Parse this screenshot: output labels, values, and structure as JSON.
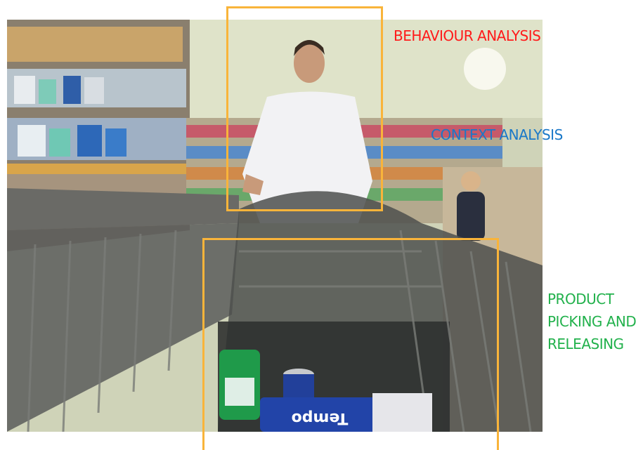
{
  "labels": {
    "behaviour": "BEHAVIOUR ANALYSIS",
    "context": "CONTEXT ANALYSIS",
    "product": "PRODUCT PICKING AND RELEASING"
  },
  "colors": {
    "behaviour": "#ff1a1a",
    "context": "#1a78c8",
    "product": "#22b14c",
    "box": "#f9b43a"
  },
  "scene": {
    "package_text": "Tempo"
  }
}
